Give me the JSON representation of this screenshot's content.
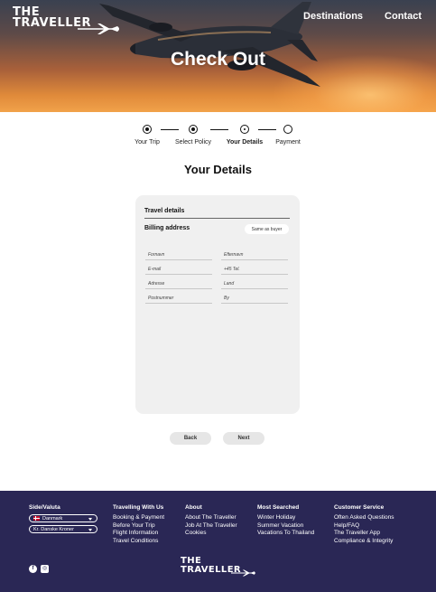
{
  "brand": {
    "line1": "THE",
    "line2": "TRAVELLER"
  },
  "nav": {
    "destinations": "Destinations",
    "contact": "Contact"
  },
  "hero": {
    "title": "Check Out"
  },
  "stepper": {
    "steps": [
      {
        "label": "Your Trip",
        "state": "done"
      },
      {
        "label": "Select Policy",
        "state": "done"
      },
      {
        "label": "Your Details",
        "state": "current"
      },
      {
        "label": "Payment",
        "state": "todo"
      }
    ]
  },
  "section": {
    "title": "Your Details"
  },
  "form": {
    "tab_travel": "Travel details",
    "billing_title": "Billing address",
    "same_as_buyer": "Same as buyer",
    "fields": {
      "first_name": "Fornavn",
      "last_name": "Efternavn",
      "email": "E-mail",
      "phone": "+45 Tel.",
      "address": "Adresse",
      "country": "Land",
      "postal": "Postnummer",
      "city": "By"
    }
  },
  "buttons": {
    "back": "Back",
    "next": "Next"
  },
  "footer": {
    "side": {
      "title": "Side/Valuta",
      "country": "Danmark",
      "currency": "Kr. Danske Kroner"
    },
    "travelling": {
      "title": "Travelling With Us",
      "links": [
        "Booking & Payment",
        "Before Your Trip",
        "Flight Information",
        "Travel Conditions"
      ]
    },
    "about": {
      "title": "About",
      "links": [
        "About The Traveller",
        "Job At The Traveller",
        "Cookies"
      ]
    },
    "most": {
      "title": "Most Searched",
      "links": [
        "Winter Holiday",
        "Summer Vacation",
        "Vacations To Thailand"
      ]
    },
    "service": {
      "title": "Customer Service",
      "links": [
        "Often Asked Questions",
        "Help/FAQ",
        "The Traveller App",
        "Compliance & Integrity"
      ]
    },
    "social": {
      "facebook_icon": "facebook-icon",
      "instagram_icon": "instagram-icon"
    },
    "brand": {
      "line1": "THE",
      "line2": "TRAVELLER"
    }
  },
  "colors": {
    "footer_bg": "#2a2755",
    "hero_sky_top": "#3a4150",
    "hero_sky_bottom": "#f1a24a"
  }
}
